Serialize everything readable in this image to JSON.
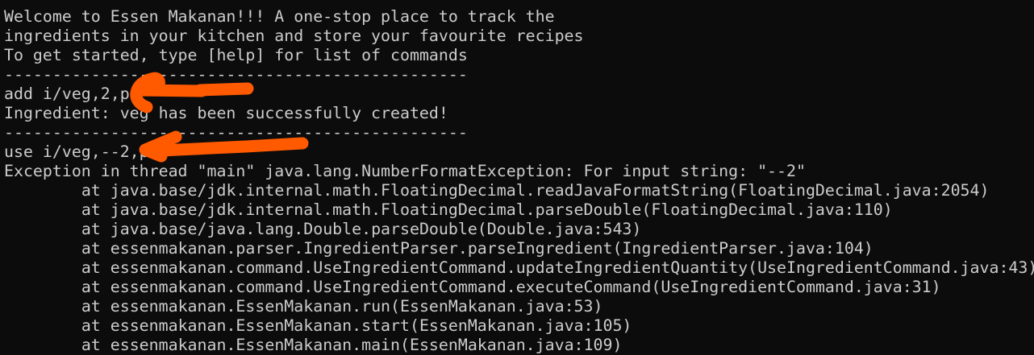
{
  "terminal": {
    "lines": [
      "Welcome to Essen Makanan!!! A one-stop place to track the",
      "ingredients in your kitchen and store your favourite recipes",
      "To get started, type [help] for list of commands",
      "------------------------------------------------",
      "add i/veg,2,pc",
      "Ingredient: veg has been successfully created!",
      "------------------------------------------------",
      "use i/veg,--2,pc",
      "Exception in thread \"main\" java.lang.NumberFormatException: For input string: \"--2\"",
      "\tat java.base/jdk.internal.math.FloatingDecimal.readJavaFormatString(FloatingDecimal.java:2054)",
      "\tat java.base/jdk.internal.math.FloatingDecimal.parseDouble(FloatingDecimal.java:110)",
      "\tat java.base/java.lang.Double.parseDouble(Double.java:543)",
      "\tat essenmakanan.parser.IngredientParser.parseIngredient(IngredientParser.java:104)",
      "\tat essenmakanan.command.UseIngredientCommand.updateIngredientQuantity(UseIngredientCommand.java:43)",
      "\tat essenmakanan.command.UseIngredientCommand.executeCommand(UseIngredientCommand.java:31)",
      "\tat essenmakanan.EssenMakanan.run(EssenMakanan.java:53)",
      "\tat essenmakanan.EssenMakanan.start(EssenMakanan.java:105)",
      "\tat essenmakanan.EssenMakanan.main(EssenMakanan.java:109)"
    ]
  },
  "colors": {
    "background": "#0c0c0c",
    "text": "#cccccc",
    "annotation": "#ff5a00"
  },
  "annotations": [
    "arrow-icon",
    "arrow-icon"
  ]
}
